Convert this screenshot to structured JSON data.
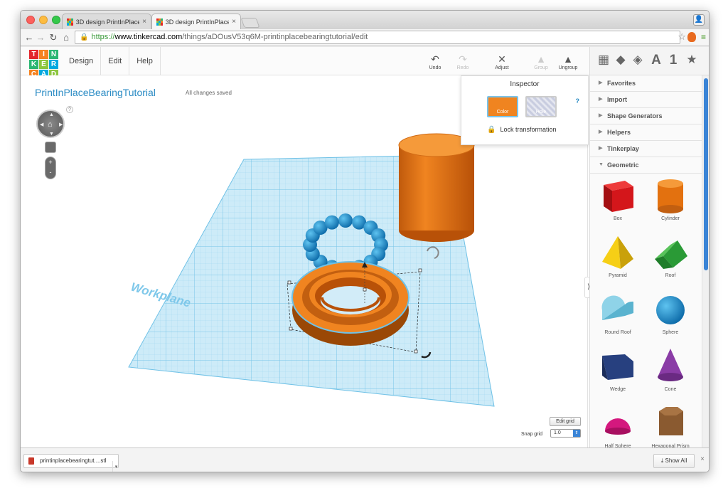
{
  "browser": {
    "tabs": [
      {
        "title": "3D design PrintInPlaceBea...",
        "close": "×"
      },
      {
        "title": "3D design PrintInPlaceBea...",
        "close": "×"
      }
    ],
    "url": {
      "scheme": "https://",
      "host": "www.tinkercad.com",
      "path": "/things/aDOusV53q6M-printinplacebearingtutorial/edit"
    }
  },
  "app": {
    "logo_letters": [
      "T",
      "I",
      "N",
      "K",
      "E",
      "R",
      "C",
      "A",
      "D"
    ],
    "logo_colors": [
      "#e3262c",
      "#f58220",
      "#2bb673",
      "#2bb673",
      "#8dc63f",
      "#00a9e0",
      "#f58220",
      "#00a9e0",
      "#8dc63f"
    ],
    "menu": [
      "Design",
      "Edit",
      "Help"
    ],
    "tools": {
      "undo": "Undo",
      "redo": "Redo",
      "adjust": "Adjust",
      "group": "Group",
      "ungroup": "Ungroup"
    },
    "project_title": "PrintInPlaceBearingTutorial",
    "save_status": "All changes saved",
    "help_mark": "?",
    "workplane_label": "Workplane",
    "inspector": {
      "title": "Inspector",
      "help": "?",
      "color_label": "Color",
      "hole_label": "Hole",
      "lock_label": "Lock transformation",
      "selected_color": "#f08420"
    },
    "edit_grid": "Edit grid",
    "snap_grid_label": "Snap grid",
    "snap_grid_value": "1.0"
  },
  "panel": {
    "header_icons": [
      "grid-icon",
      "cube-icon",
      "cube-outline-icon",
      "letter-a-icon",
      "number-1-icon",
      "star-icon"
    ],
    "header_text": {
      "letter": "A",
      "number": "1",
      "star": "★"
    },
    "categories": [
      {
        "label": "Favorites",
        "expanded": false
      },
      {
        "label": "Import",
        "expanded": false
      },
      {
        "label": "Shape Generators",
        "expanded": false
      },
      {
        "label": "Helpers",
        "expanded": false
      },
      {
        "label": "Tinkerplay",
        "expanded": false
      },
      {
        "label": "Geometric",
        "expanded": true
      }
    ],
    "shapes": [
      "Box",
      "Cylinder",
      "Pyramid",
      "Roof",
      "Round Roof",
      "Sphere",
      "Wedge",
      "Cone",
      "Half Sphere",
      "Hexagonal Prism"
    ]
  },
  "downloads": {
    "file": "printinplacebearingtut....stl",
    "show_all": "Show All"
  }
}
